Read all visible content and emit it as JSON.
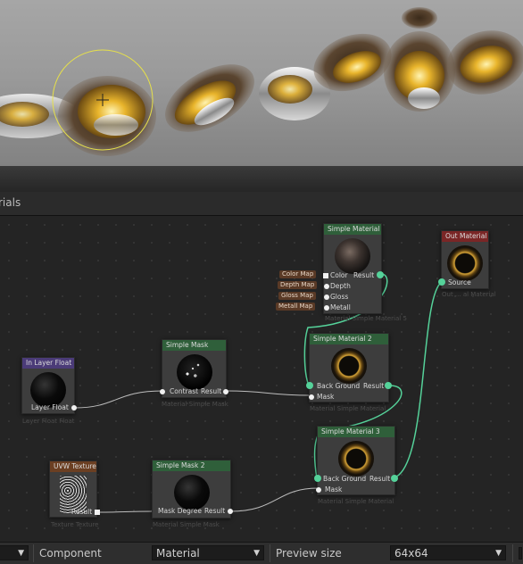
{
  "panel": {
    "title": "rials"
  },
  "nodes": {
    "simple_material": {
      "title": "Simple Material",
      "inputs": [
        "Color",
        "Depth",
        "Gloss",
        "Metall"
      ],
      "output": "Result",
      "caption": "Material Simple Material 5"
    },
    "out_material": {
      "title": "Out Material",
      "input": "Source",
      "caption": "Out ... al Material"
    },
    "in_layer": {
      "title": "In Layer Float",
      "output": "Layer Float",
      "caption": "Layer Float Float"
    },
    "simple_mask": {
      "title": "Simple Mask",
      "input": "Contrast",
      "output": "Result",
      "caption": "Material Simple Mask"
    },
    "simple_material_2": {
      "title": "Simple Material 2",
      "inputs": [
        "Back Ground",
        "Mask"
      ],
      "output": "Result",
      "caption": "Material Simple Material"
    },
    "simple_material_3": {
      "title": "Simple Material 3",
      "inputs": [
        "Back Ground",
        "Mask"
      ],
      "output": "Result",
      "caption": "Material Simple Material"
    },
    "uvw_texture": {
      "title": "UVW Texture",
      "output": "Result",
      "caption": "Texture Texture"
    },
    "simple_mask_2": {
      "title": "Simple Mask 2",
      "input": "Mask Degree",
      "output": "Result",
      "caption": "Material Simple Mask"
    }
  },
  "map_tags": [
    "Color Map",
    "Depth Map",
    "Gloss Map",
    "Metall Map"
  ],
  "statusbar": {
    "component_label": "Component",
    "component_value": "Material",
    "preview_label": "Preview size",
    "preview_value": "64x64"
  },
  "colors": {
    "wire_green": "#55d29a",
    "wire_gray": "#bdbdbd",
    "brush_ring": "#e6e04a"
  }
}
